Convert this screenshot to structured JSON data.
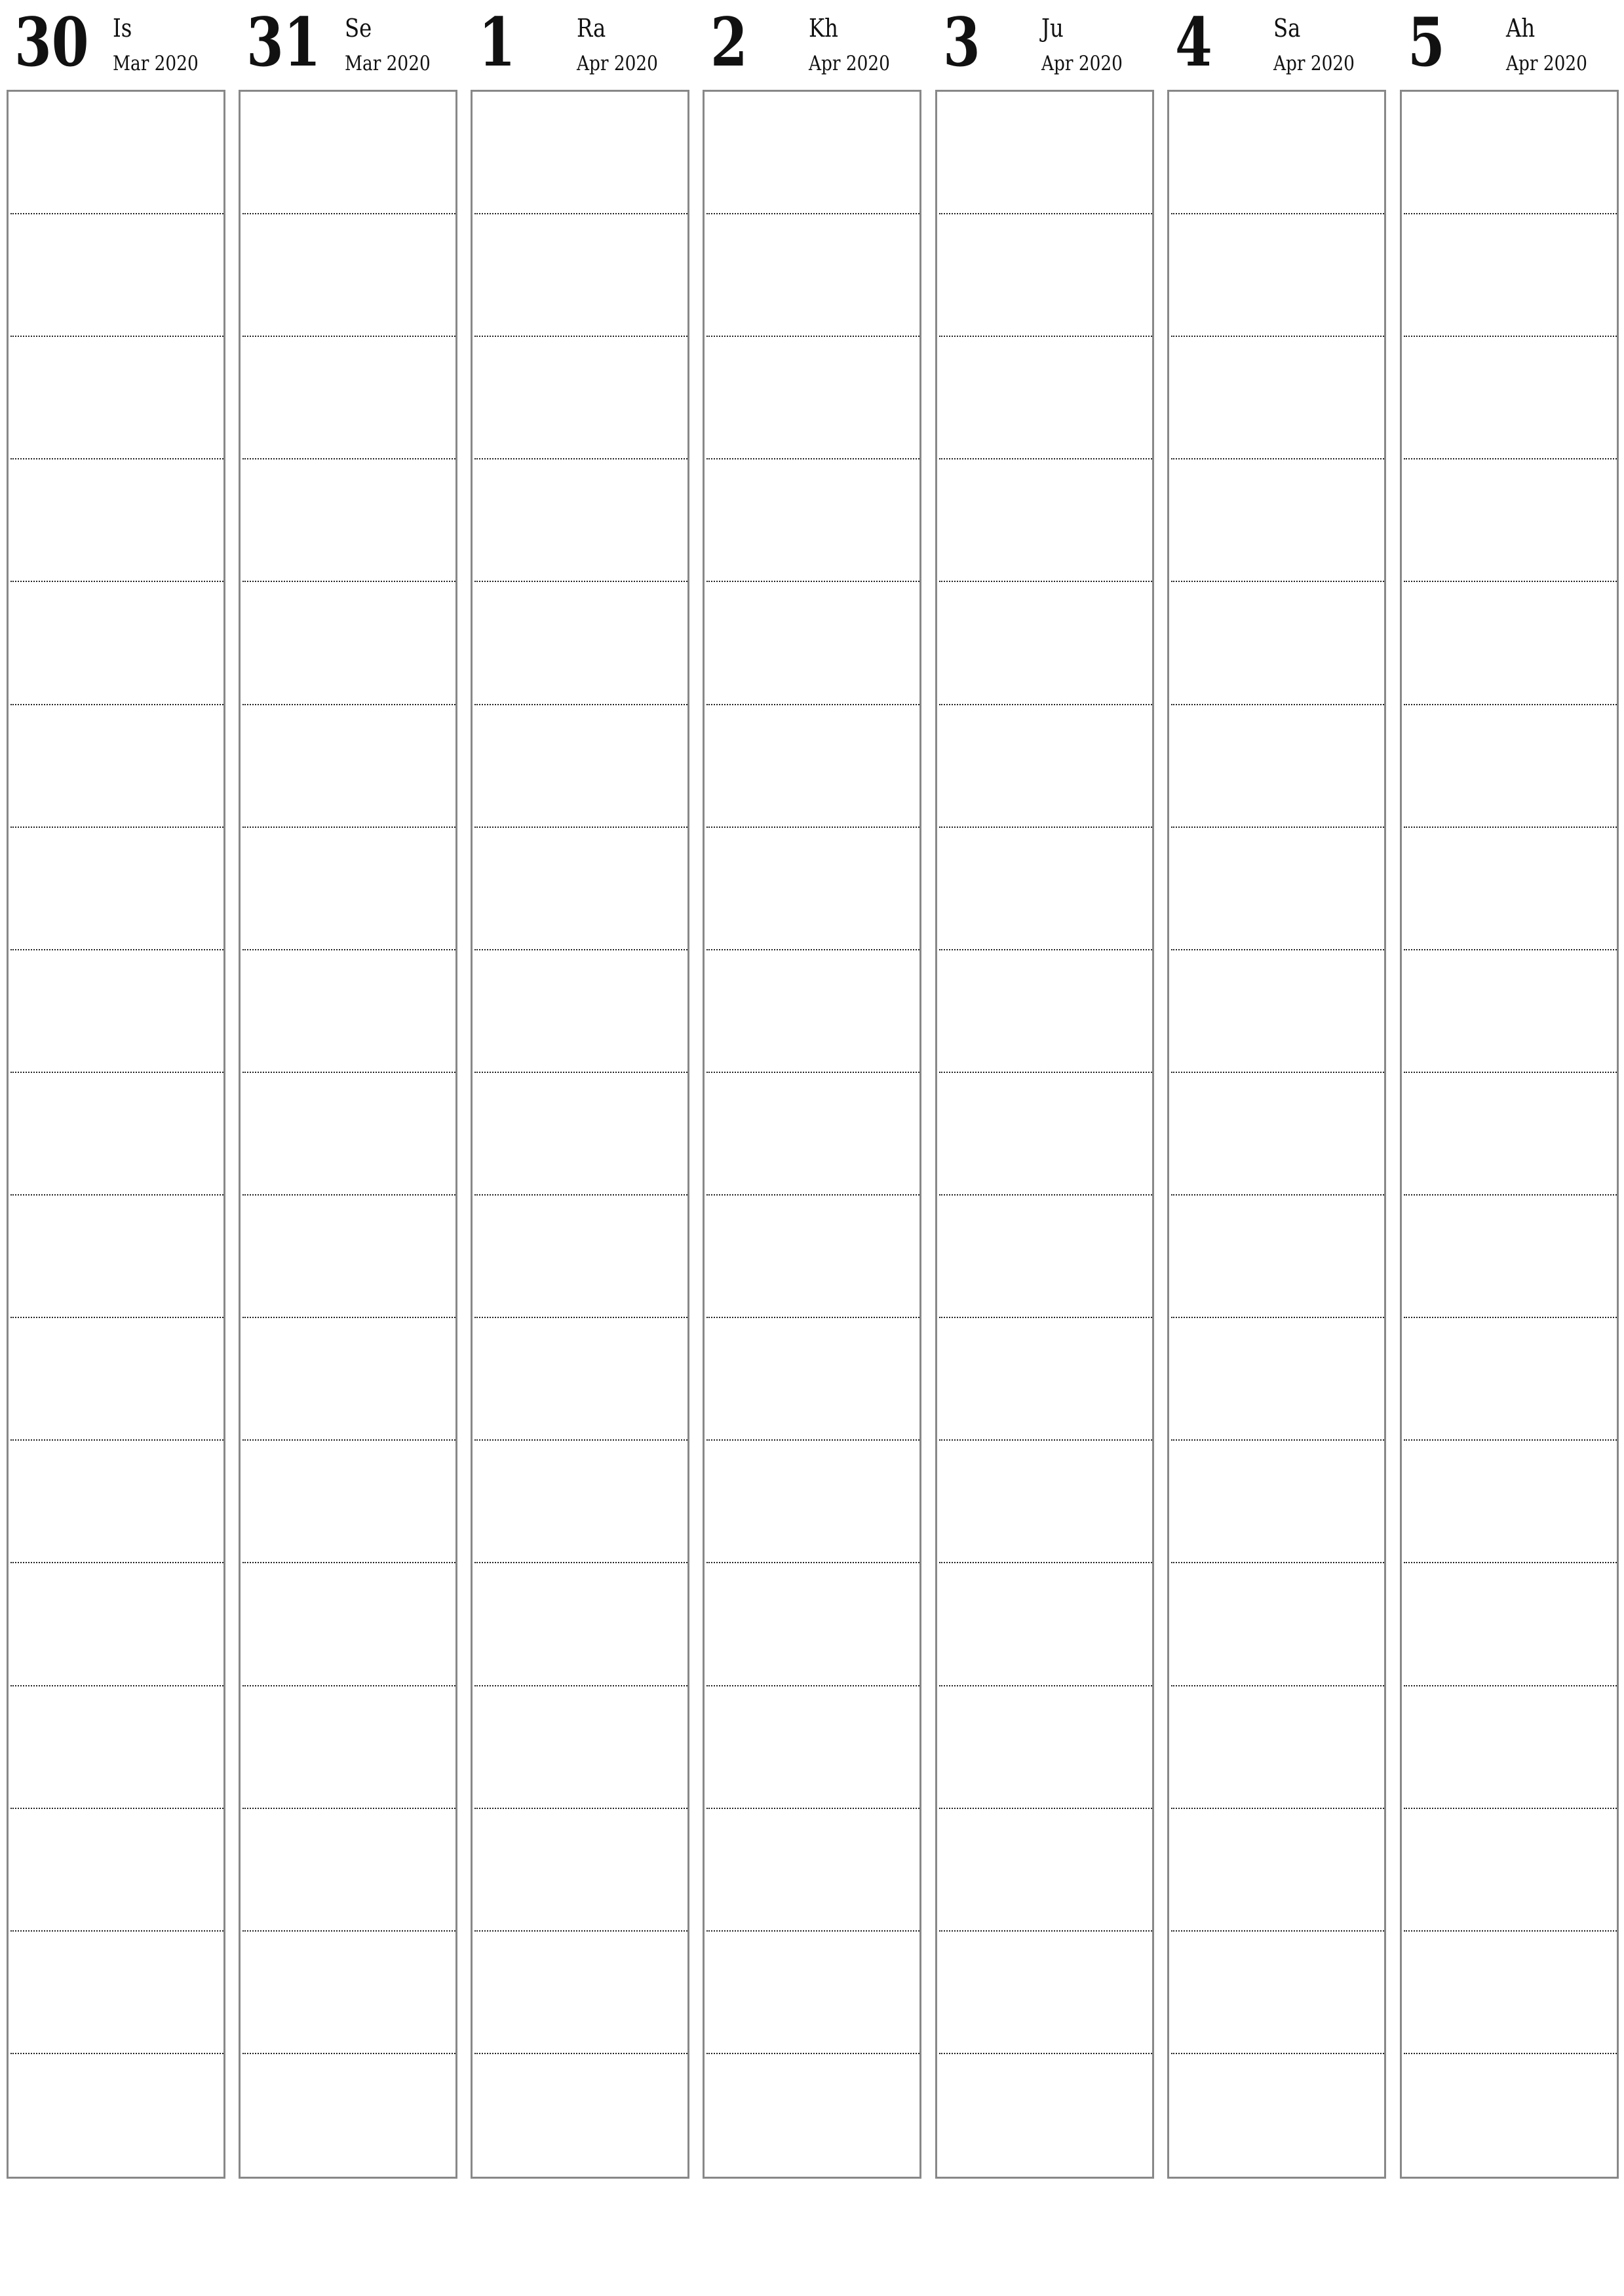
{
  "planner": {
    "type": "weekly",
    "slots_per_day": 17,
    "days": [
      {
        "number": "30",
        "weekday": "Is",
        "month_year": "Mar 2020"
      },
      {
        "number": "31",
        "weekday": "Se",
        "month_year": "Mar 2020"
      },
      {
        "number": "1",
        "weekday": "Ra",
        "month_year": "Apr 2020"
      },
      {
        "number": "2",
        "weekday": "Kh",
        "month_year": "Apr 2020"
      },
      {
        "number": "3",
        "weekday": "Ju",
        "month_year": "Apr 2020"
      },
      {
        "number": "4",
        "weekday": "Sa",
        "month_year": "Apr 2020"
      },
      {
        "number": "5",
        "weekday": "Ah",
        "month_year": "Apr 2020"
      }
    ]
  },
  "colors": {
    "border": "#888888",
    "dotted_line": "#222222",
    "text": "#111111",
    "background": "#ffffff"
  }
}
